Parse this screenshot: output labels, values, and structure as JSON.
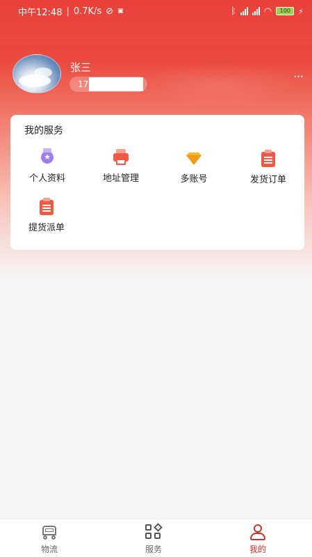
{
  "status_bar": {
    "time": "中午12:48",
    "speed": "0.7K/s",
    "battery": "100"
  },
  "profile": {
    "name": "张三",
    "phone_prefix": "17",
    "more": "···"
  },
  "services": {
    "title": "我的服务",
    "items": [
      {
        "label": "个人资料",
        "icon": "medal-icon"
      },
      {
        "label": "地址管理",
        "icon": "printer-icon"
      },
      {
        "label": "多账号",
        "icon": "diamond-icon"
      },
      {
        "label": "发货订单",
        "icon": "clipboard-icon"
      },
      {
        "label": "提货派单",
        "icon": "clipboard-icon"
      }
    ]
  },
  "tabbar": {
    "tabs": [
      {
        "label": "物流",
        "icon": "truck-icon",
        "active": false
      },
      {
        "label": "服务",
        "icon": "grid-icon",
        "active": false
      },
      {
        "label": "我的",
        "icon": "user-icon",
        "active": true
      }
    ]
  },
  "colors": {
    "brand_red": "#e8413a",
    "active_tab": "#c9322a"
  }
}
